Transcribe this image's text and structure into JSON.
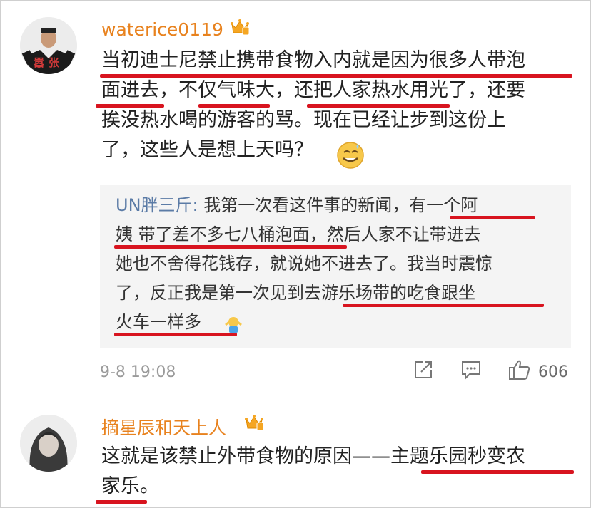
{
  "comment1": {
    "username": "waterice0119",
    "avatar_caption": "嚣张",
    "lines": [
      "当初迪士尼禁止携带食物入内就是因为很多人带泡",
      "面进去，不仅气味大，还把人家热水用光了，还要",
      "挨没热水喝的游客的骂。现在已经让步到这份上",
      "了，这些人是想上天吗？"
    ],
    "reply": {
      "name": "UN胖三斤:",
      "lines": [
        " 我第一次看这件事的新闻，有一个阿",
        "姨 带了差不多七八桶泡面，然后人家不让带进去",
        "她也不舍得花钱存，就说她不进去了。我当时震惊",
        "了，反正我是第一次见到去游乐场带的吃食跟坐",
        "火车一样多"
      ]
    },
    "timestamp": "9-8 19:08",
    "likes": "606"
  },
  "comment2": {
    "username": "摘星辰和天上人",
    "lines": [
      "这就是该禁止外带食物的原因——主题乐园秒变农",
      "家乐。"
    ]
  },
  "icons": {
    "crown": "vip-crown-icon",
    "share": "share-icon",
    "comment": "comment-icon",
    "like": "thumbs-up-icon",
    "emoji1": "sweat-smile-emoji",
    "emoji2": "shrug-emoji"
  },
  "colors": {
    "username": "#e8821e",
    "reply_name": "#5b7ba6",
    "underline": "#d8141f",
    "meta": "#9a9a9a"
  }
}
